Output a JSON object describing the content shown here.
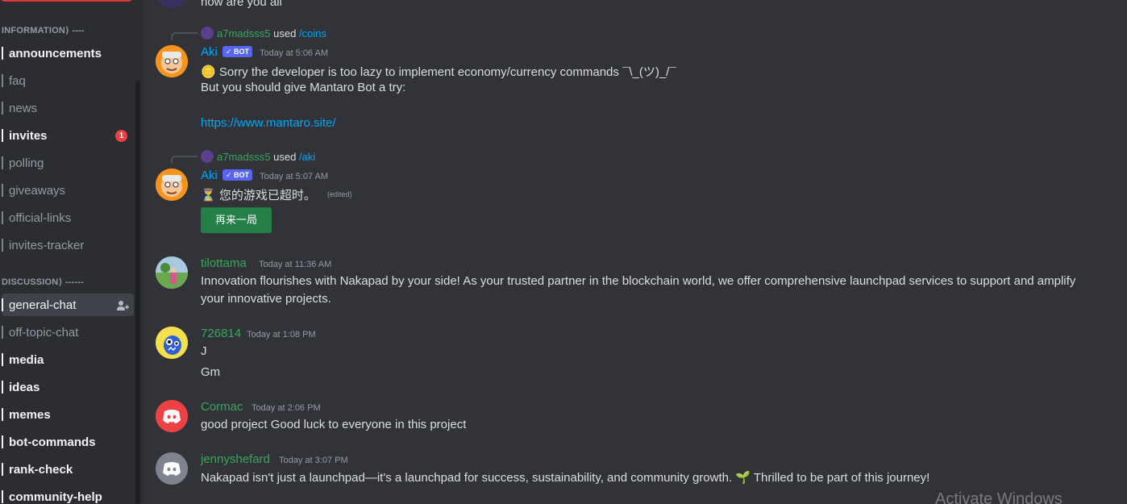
{
  "sidebar": {
    "categories": [
      {
        "label": "INFORMATION⟩ ----"
      },
      {
        "label": "DISCUSSION⟩ ------"
      }
    ],
    "channels": [
      {
        "label": "announcements"
      },
      {
        "label": "faq"
      },
      {
        "label": "news"
      },
      {
        "label": "invites",
        "badge": "1"
      },
      {
        "label": "polling"
      },
      {
        "label": "giveaways"
      },
      {
        "label": "official-links"
      },
      {
        "label": "invites-tracker"
      },
      {
        "label": "general-chat"
      },
      {
        "label": "off-topic-chat"
      },
      {
        "label": "media"
      },
      {
        "label": "ideas"
      },
      {
        "label": "memes"
      },
      {
        "label": "bot-commands"
      },
      {
        "label": "rank-check"
      },
      {
        "label": "community-help"
      }
    ]
  },
  "messages": {
    "top_partial": "how are you all",
    "m1": {
      "reply_user": "a7madsss5",
      "reply_used": "used",
      "reply_command": "/coins",
      "username": "Aki",
      "bot_tag": "✓ BOT",
      "timestamp": "Today at 5:06 AM",
      "line1": "🪙 Sorry the developer is too lazy to implement economy/currency commands ¯\\_(ツ)_/¯",
      "line2": "But you should give Mantaro Bot a try:",
      "link": "https://www.mantaro.site/"
    },
    "m2": {
      "reply_user": "a7madsss5",
      "reply_used": "used",
      "reply_command": "/aki",
      "username": "Aki",
      "bot_tag": "✓ BOT",
      "timestamp": "Today at 5:07 AM",
      "text": "⏳ 您的游戏已超时。",
      "edited": "(edited)",
      "button": "再来一局"
    },
    "m3": {
      "username": "tilottama",
      "timestamp": "Today at 11:36 AM",
      "line1": "Innovation flourishes with Nakapad by your side! As your trusted partner in the blockchain world, we offer comprehensive launchpad services to support and amplify",
      "line2": "your innovative projects."
    },
    "m4": {
      "username": "726814",
      "timestamp": "Today at 1:08 PM",
      "line1": "J",
      "line2": "Gm"
    },
    "m5": {
      "username": "Cormac",
      "timestamp": "Today at 2:06 PM",
      "text": "good project Good luck to everyone in this project"
    },
    "m6": {
      "username": "jennyshefard",
      "timestamp": "Today at 3:07 PM",
      "text": "Nakapad isn't just a launchpad—it's a launchpad for success, sustainability, and community growth. 🌱 Thrilled to be part of this journey!"
    }
  },
  "watermark": "Activate Windows",
  "colors": {
    "background": "#313338",
    "sidebar": "#2b2d31",
    "bot_name": "#00a8fc",
    "user_name": "#3ba55c",
    "link": "#00a8fc",
    "bot_tag": "#5865f2",
    "button": "#248046",
    "cormac_avatar": "#ed4245",
    "jenny_avatar": "#80848e"
  }
}
